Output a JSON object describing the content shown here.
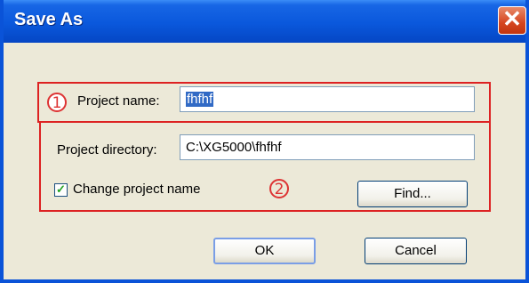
{
  "window": {
    "title": "Save As"
  },
  "form": {
    "project_name_label": "Project name:",
    "project_name_value": "fhfhf",
    "project_directory_label": "Project directory:",
    "project_directory_value": "C:\\XG5000\\fhfhf",
    "change_name_label": "Change project name",
    "change_name_checked": true
  },
  "annotations": {
    "marker1": "1",
    "marker2": "2"
  },
  "buttons": {
    "find": "Find...",
    "ok": "OK",
    "cancel": "Cancel"
  },
  "colors": {
    "title_bar": "#0a58dc",
    "highlight_box": "#dd2222",
    "selection": "#316ac5",
    "check": "#21a121"
  },
  "icons": {
    "close": "close-icon",
    "check": "checkmark-icon"
  }
}
